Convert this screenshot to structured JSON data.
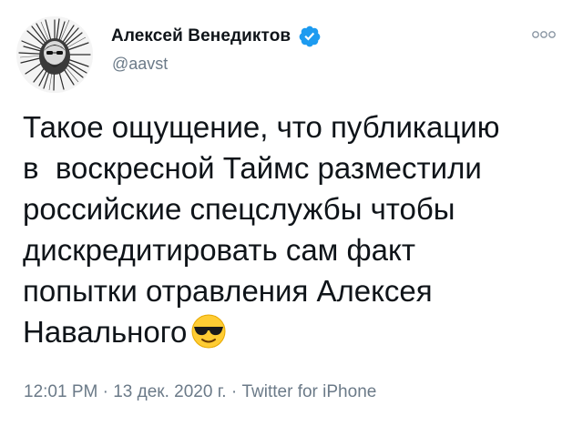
{
  "author": {
    "name": "Алексей Венедиктов",
    "handle": "@aavst",
    "verified_color": "#1d9bf0"
  },
  "icons": {
    "more": "more-dots-icon",
    "verified": "verified-badge-icon",
    "emoji": "sunglasses-face-emoji"
  },
  "tweet": {
    "lines": [
      "Такое ощущение, что публикацию",
      "в  воскресной Таймс разместили",
      "российские спецслужбы чтобы",
      "дискредитировать сам факт",
      "попытки отравления Алексея",
      "Навального"
    ]
  },
  "meta": {
    "time": "12:01 PM",
    "date": "13 дек. 2020 г.",
    "source": "Twitter for iPhone",
    "separator": " · "
  }
}
